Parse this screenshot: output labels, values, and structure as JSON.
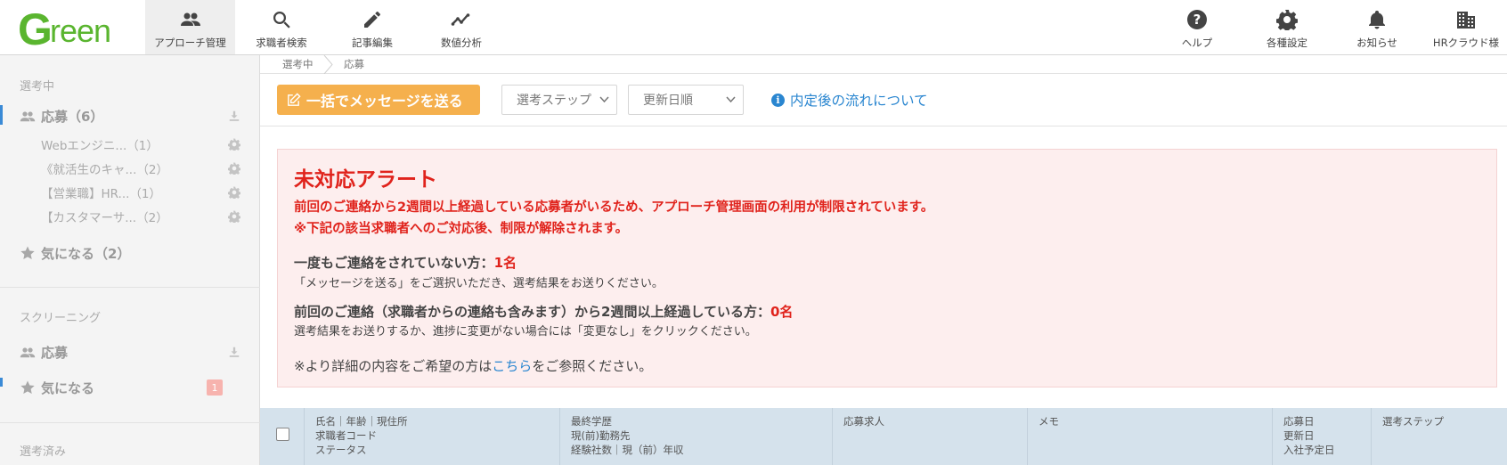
{
  "app": {
    "logo_first": "G",
    "logo_rest": "reen",
    "brand_color": "#5ab52f"
  },
  "nav": {
    "approach": "アプローチ管理",
    "search": "求職者検索",
    "articles": "記事編集",
    "analytics": "数値分析",
    "help": "ヘルプ",
    "settings": "各種設定",
    "notifications": "お知らせ",
    "account": "HRクラウド様"
  },
  "sidebar": {
    "section_selecting": "選考中",
    "applied": "応募（6）",
    "jobs": [
      "Webエンジニ...（1）",
      "《就活生のキャ...（2）",
      "【営業職】HR...（1）",
      "【カスタマーサ...（2）"
    ],
    "favorite": "気になる（2）",
    "section_screening": "スクリーニング",
    "screening_applied": "応募",
    "screening_favorite": "気になる",
    "screening_badge": "1",
    "section_done": "選考済み"
  },
  "breadcrumb": {
    "level1": "選考中",
    "level2": "応募"
  },
  "toolbar": {
    "send_all": "一括でメッセージを送る",
    "step_select": "選考ステップ",
    "sort_select": "更新日順",
    "info_link": "内定後の流れについて"
  },
  "alert": {
    "title": "未対応アラート",
    "line1": "前回のご連絡から2週間以上経過している応募者がいるため、アプローチ管理画面の利用が制限されています。",
    "line2": "※下記の該当求職者へのご対応後、制限が解除されます。",
    "h1_label": "一度もご連絡をされていない方：",
    "h1_count": "1名",
    "d1": "「メッセージを送る」をご選択いただき、選考結果をお送りください。",
    "h2_label": "前回のご連絡（求職者からの連絡も含みます）から2週間以上経過している方：",
    "h2_count": "0名",
    "d2": "選考結果をお送りするか、進捗に変更がない場合には「変更なし」をクリックください。",
    "note_prefix": "※より詳細の内容をご希望の方は",
    "note_link": "こちら",
    "note_suffix": "をご参照ください。"
  },
  "table": {
    "col1": [
      "氏名｜年齢｜現住所",
      "求職者コード",
      "ステータス"
    ],
    "col2": [
      "最終学歴",
      "現(前)勤務先",
      "経験社数｜現（前）年収"
    ],
    "col3": [
      "応募求人"
    ],
    "col4": [
      "メモ"
    ],
    "col5": [
      "応募日",
      "更新日",
      "入社予定日"
    ],
    "col6": [
      "選考ステップ"
    ]
  }
}
